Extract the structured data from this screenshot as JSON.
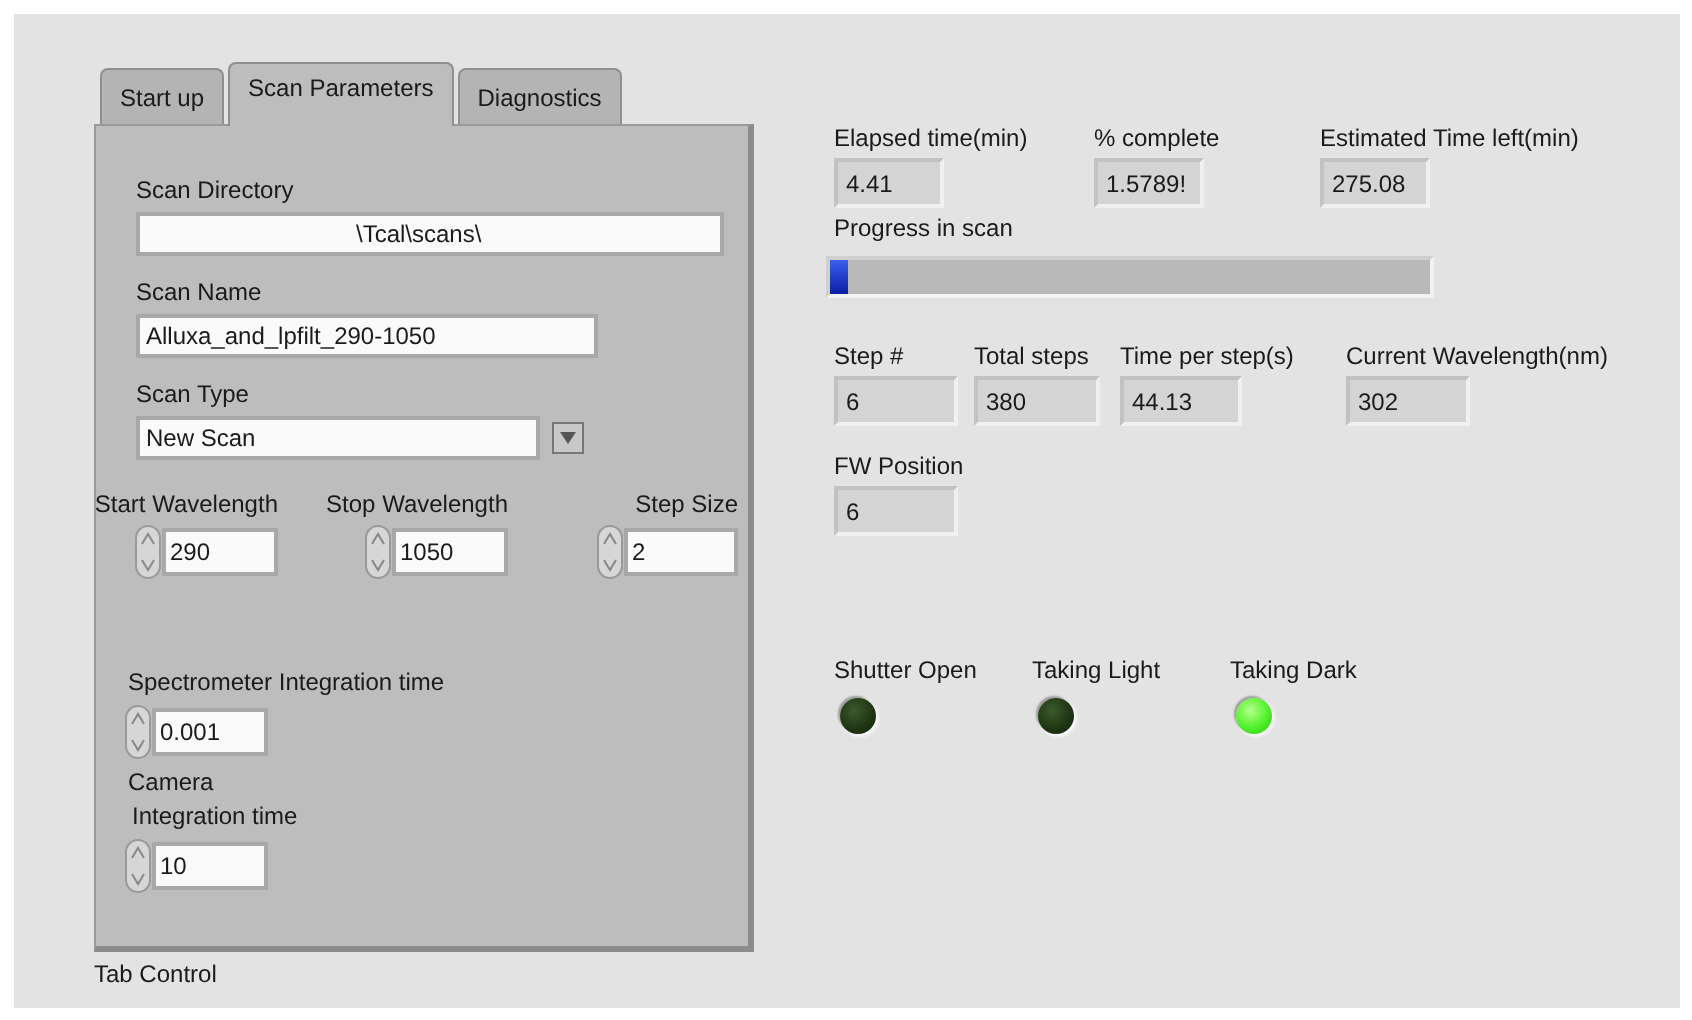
{
  "tabs": [
    {
      "label": "Start up",
      "selected": false
    },
    {
      "label": "Scan Parameters",
      "selected": true
    },
    {
      "label": "Diagnostics",
      "selected": false
    }
  ],
  "scan_directory": {
    "label": "Scan Directory",
    "value": "\\Tcal\\scans\\"
  },
  "scan_name": {
    "label": "Scan Name",
    "value": "Alluxa_and_lpfilt_290-1050"
  },
  "scan_type": {
    "label": "Scan Type",
    "value": "New Scan"
  },
  "wavelength_controls": [
    {
      "label": "Start Wavelength",
      "value": "290"
    },
    {
      "label": "Stop Wavelength",
      "value": "1050"
    },
    {
      "label": "Step Size",
      "value": "2"
    }
  ],
  "spectrometer_integration": {
    "label": "Spectrometer Integration time",
    "value": "0.001"
  },
  "camera_integration": {
    "label_lines": [
      "Camera",
      "Integration time"
    ],
    "value": "10"
  },
  "tab_control_label": "Tab Control",
  "time_indicators": [
    {
      "label": "Elapsed time(min)",
      "value": "4.41"
    },
    {
      "label": "% complete",
      "value": "1.5789!"
    },
    {
      "label": "Estimated Time left(min)",
      "value": "275.08"
    }
  ],
  "progress": {
    "label": "Progress in scan",
    "level": 0.03
  },
  "step_indicators": [
    {
      "label": "Step #",
      "value": "6"
    },
    {
      "label": "Total steps",
      "value": "380"
    },
    {
      "label": "Time per step(s)",
      "value": "44.13"
    },
    {
      "label": "Current Wavelength(nm)",
      "value": "302"
    }
  ],
  "fw_position": {
    "label": "FW Position",
    "value": "6"
  },
  "leds": [
    {
      "label": "Shutter Open",
      "on": false
    },
    {
      "label": "Taking Light",
      "on": false
    },
    {
      "label": "Taking Dark",
      "on": true
    }
  ]
}
